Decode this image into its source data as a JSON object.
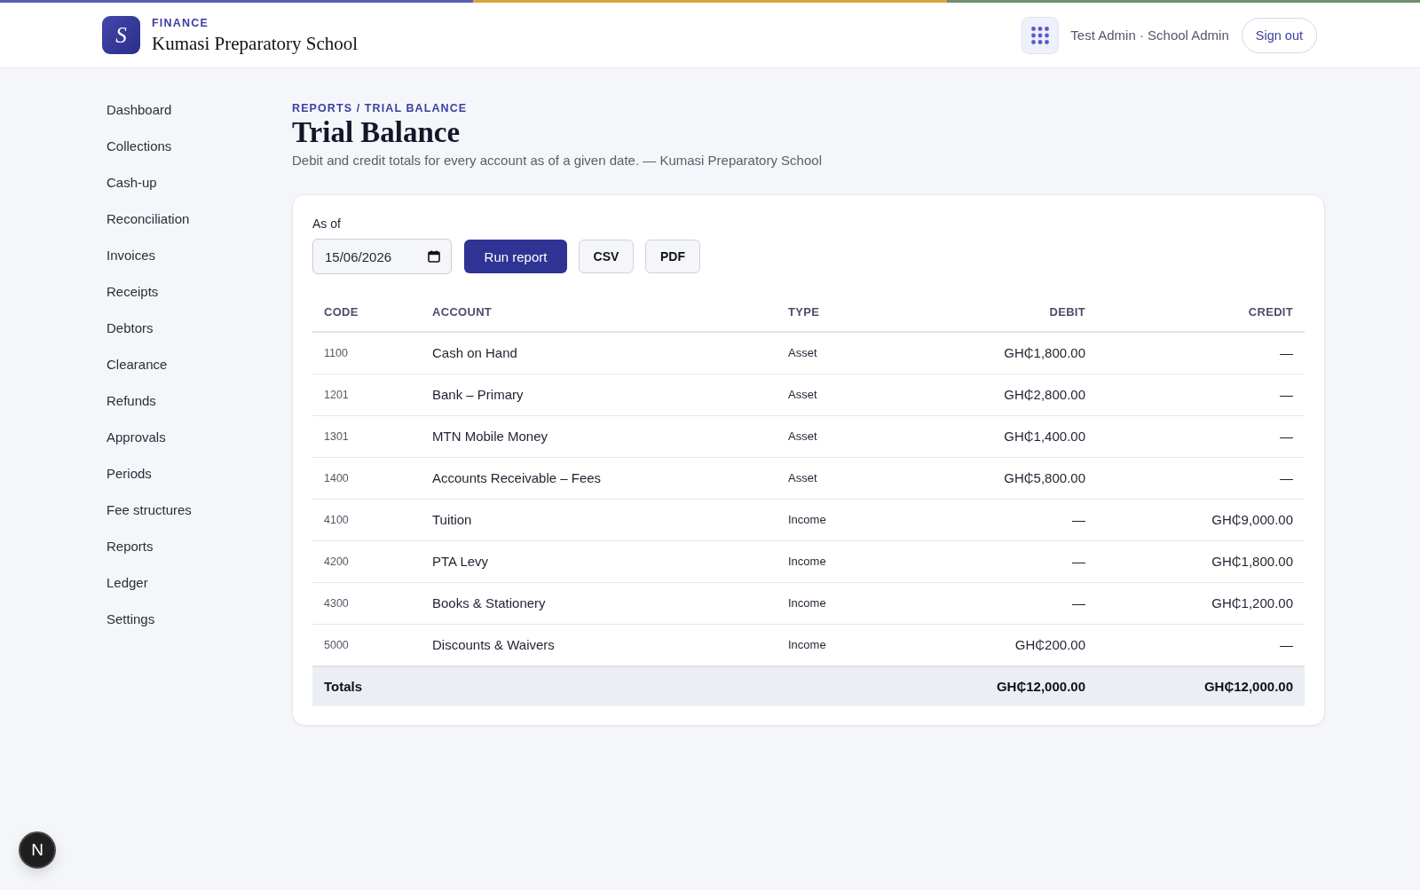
{
  "header": {
    "logo_letter": "S",
    "section": "FINANCE",
    "school_name": "Kumasi Preparatory School",
    "user": "Test Admin · School Admin",
    "sign_out": "Sign out"
  },
  "sidebar": {
    "items": [
      "Dashboard",
      "Collections",
      "Cash-up",
      "Reconciliation",
      "Invoices",
      "Receipts",
      "Debtors",
      "Clearance",
      "Refunds",
      "Approvals",
      "Periods",
      "Fee structures",
      "Reports",
      "Ledger",
      "Settings"
    ]
  },
  "page": {
    "breadcrumb": "REPORTS / TRIAL BALANCE",
    "title": "Trial Balance",
    "subtitle": "Debit and credit totals for every account as of a given date. — Kumasi Preparatory School"
  },
  "filters": {
    "label": "As of",
    "date_value": "15/06/2026",
    "buttons": [
      {
        "label": "Run report",
        "kind": "primary"
      },
      {
        "label": "CSV",
        "kind": "secondary"
      },
      {
        "label": "PDF",
        "kind": "secondary"
      }
    ]
  },
  "table": {
    "columns": [
      "CODE",
      "ACCOUNT",
      "TYPE",
      "DEBIT",
      "CREDIT"
    ],
    "rows": [
      {
        "code": "1100",
        "account": "Cash on Hand",
        "type": "Asset",
        "debit": "GH₵1,800.00",
        "credit": "—"
      },
      {
        "code": "1201",
        "account": "Bank – Primary",
        "type": "Asset",
        "debit": "GH₵2,800.00",
        "credit": "—"
      },
      {
        "code": "1301",
        "account": "MTN Mobile Money",
        "type": "Asset",
        "debit": "GH₵1,400.00",
        "credit": "—"
      },
      {
        "code": "1400",
        "account": "Accounts Receivable – Fees",
        "type": "Asset",
        "debit": "GH₵5,800.00",
        "credit": "—"
      },
      {
        "code": "4100",
        "account": "Tuition",
        "type": "Income",
        "debit": "—",
        "credit": "GH₵9,000.00"
      },
      {
        "code": "4200",
        "account": "PTA Levy",
        "type": "Income",
        "debit": "—",
        "credit": "GH₵1,800.00"
      },
      {
        "code": "4300",
        "account": "Books & Stationery",
        "type": "Income",
        "debit": "—",
        "credit": "GH₵1,200.00"
      },
      {
        "code": "5000",
        "account": "Discounts & Waivers",
        "type": "Income",
        "debit": "GH₵200.00",
        "credit": "—"
      }
    ],
    "totals": {
      "label": "Totals",
      "debit": "GH₵12,000.00",
      "credit": "GH₵12,000.00"
    }
  },
  "dev_badge": "N"
}
